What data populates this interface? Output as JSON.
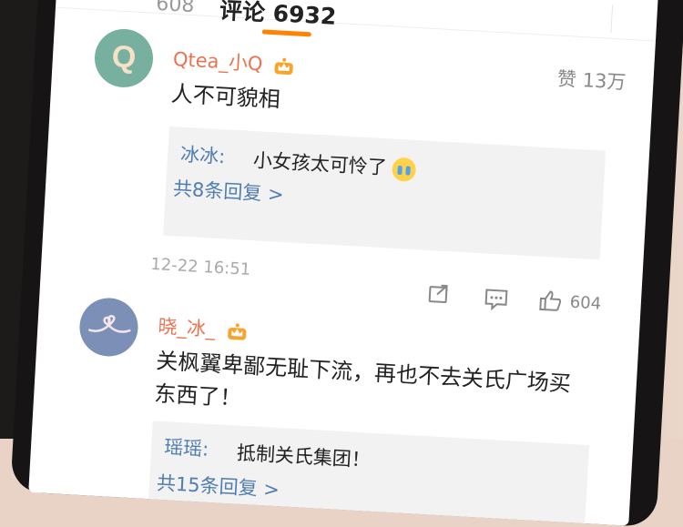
{
  "tabs": {
    "previous_partial": "608",
    "active_label": "评论 6932"
  },
  "comments": [
    {
      "user": "Qtea_小Q",
      "avatar_letter": "Q",
      "likes": "赞 13万",
      "text": "人不可貌相",
      "reply": {
        "name": "冰冰:",
        "text": "小女孩太可怜了",
        "more": "共8条回复 >"
      },
      "time": "12-22 16:51"
    },
    {
      "user": "晓_冰_",
      "text": "关枫翼卑鄙无耻下流，再也不去关氏广场买\n东西了！",
      "like_count": "604",
      "reply": {
        "name": "瑶瑶:",
        "text": "抵制关氏集团！",
        "more": "共15条回复 >"
      }
    }
  ],
  "colors": {
    "accent": "#ff8200",
    "username": "#eb7350",
    "link": "#507daf"
  }
}
